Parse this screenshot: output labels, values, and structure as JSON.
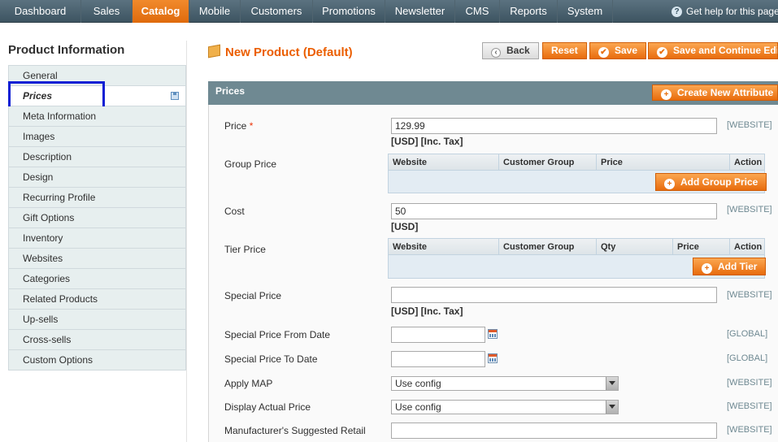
{
  "nav": {
    "items": [
      "Dashboard",
      "Sales",
      "Catalog",
      "Mobile",
      "Customers",
      "Promotions",
      "Newsletter",
      "CMS",
      "Reports",
      "System"
    ],
    "active": "Catalog",
    "help": "Get help for this page"
  },
  "sidebar": {
    "title": "Product Information",
    "items": [
      "General",
      "Prices",
      "Meta Information",
      "Images",
      "Description",
      "Design",
      "Recurring Profile",
      "Gift Options",
      "Inventory",
      "Websites",
      "Categories",
      "Related Products",
      "Up-sells",
      "Cross-sells",
      "Custom Options"
    ],
    "active": "Prices"
  },
  "header": {
    "title": "New Product (Default)",
    "buttons": {
      "back": "Back",
      "reset": "Reset",
      "save": "Save",
      "save_continue": "Save and Continue Edit"
    }
  },
  "prices": {
    "section_title": "Prices",
    "create_attribute": "Create New Attribute",
    "price": {
      "label": "Price",
      "required_mark": "*",
      "value": "129.99",
      "note": "[USD] [Inc. Tax]",
      "scope": "[WEBSITE]"
    },
    "group_price": {
      "label": "Group Price",
      "columns": [
        "Website",
        "Customer Group",
        "Price",
        "Action"
      ],
      "add_button": "Add Group Price"
    },
    "cost": {
      "label": "Cost",
      "value": "50",
      "note": "[USD]",
      "scope": "[WEBSITE]"
    },
    "tier_price": {
      "label": "Tier Price",
      "columns": [
        "Website",
        "Customer Group",
        "Qty",
        "Price",
        "Action"
      ],
      "add_button": "Add Tier"
    },
    "special_price": {
      "label": "Special Price",
      "value": "",
      "note": "[USD] [Inc. Tax]",
      "scope": "[WEBSITE]"
    },
    "special_from": {
      "label": "Special Price From Date",
      "value": "",
      "scope": "[GLOBAL]"
    },
    "special_to": {
      "label": "Special Price To Date",
      "value": "",
      "scope": "[GLOBAL]"
    },
    "apply_map": {
      "label": "Apply MAP",
      "value": "Use config",
      "scope": "[WEBSITE]"
    },
    "display_actual": {
      "label": "Display Actual Price",
      "value": "Use config",
      "scope": "[WEBSITE]"
    },
    "msrp": {
      "label": "Manufacturer's Suggested Retail",
      "value": "",
      "scope": "[WEBSITE]"
    }
  }
}
